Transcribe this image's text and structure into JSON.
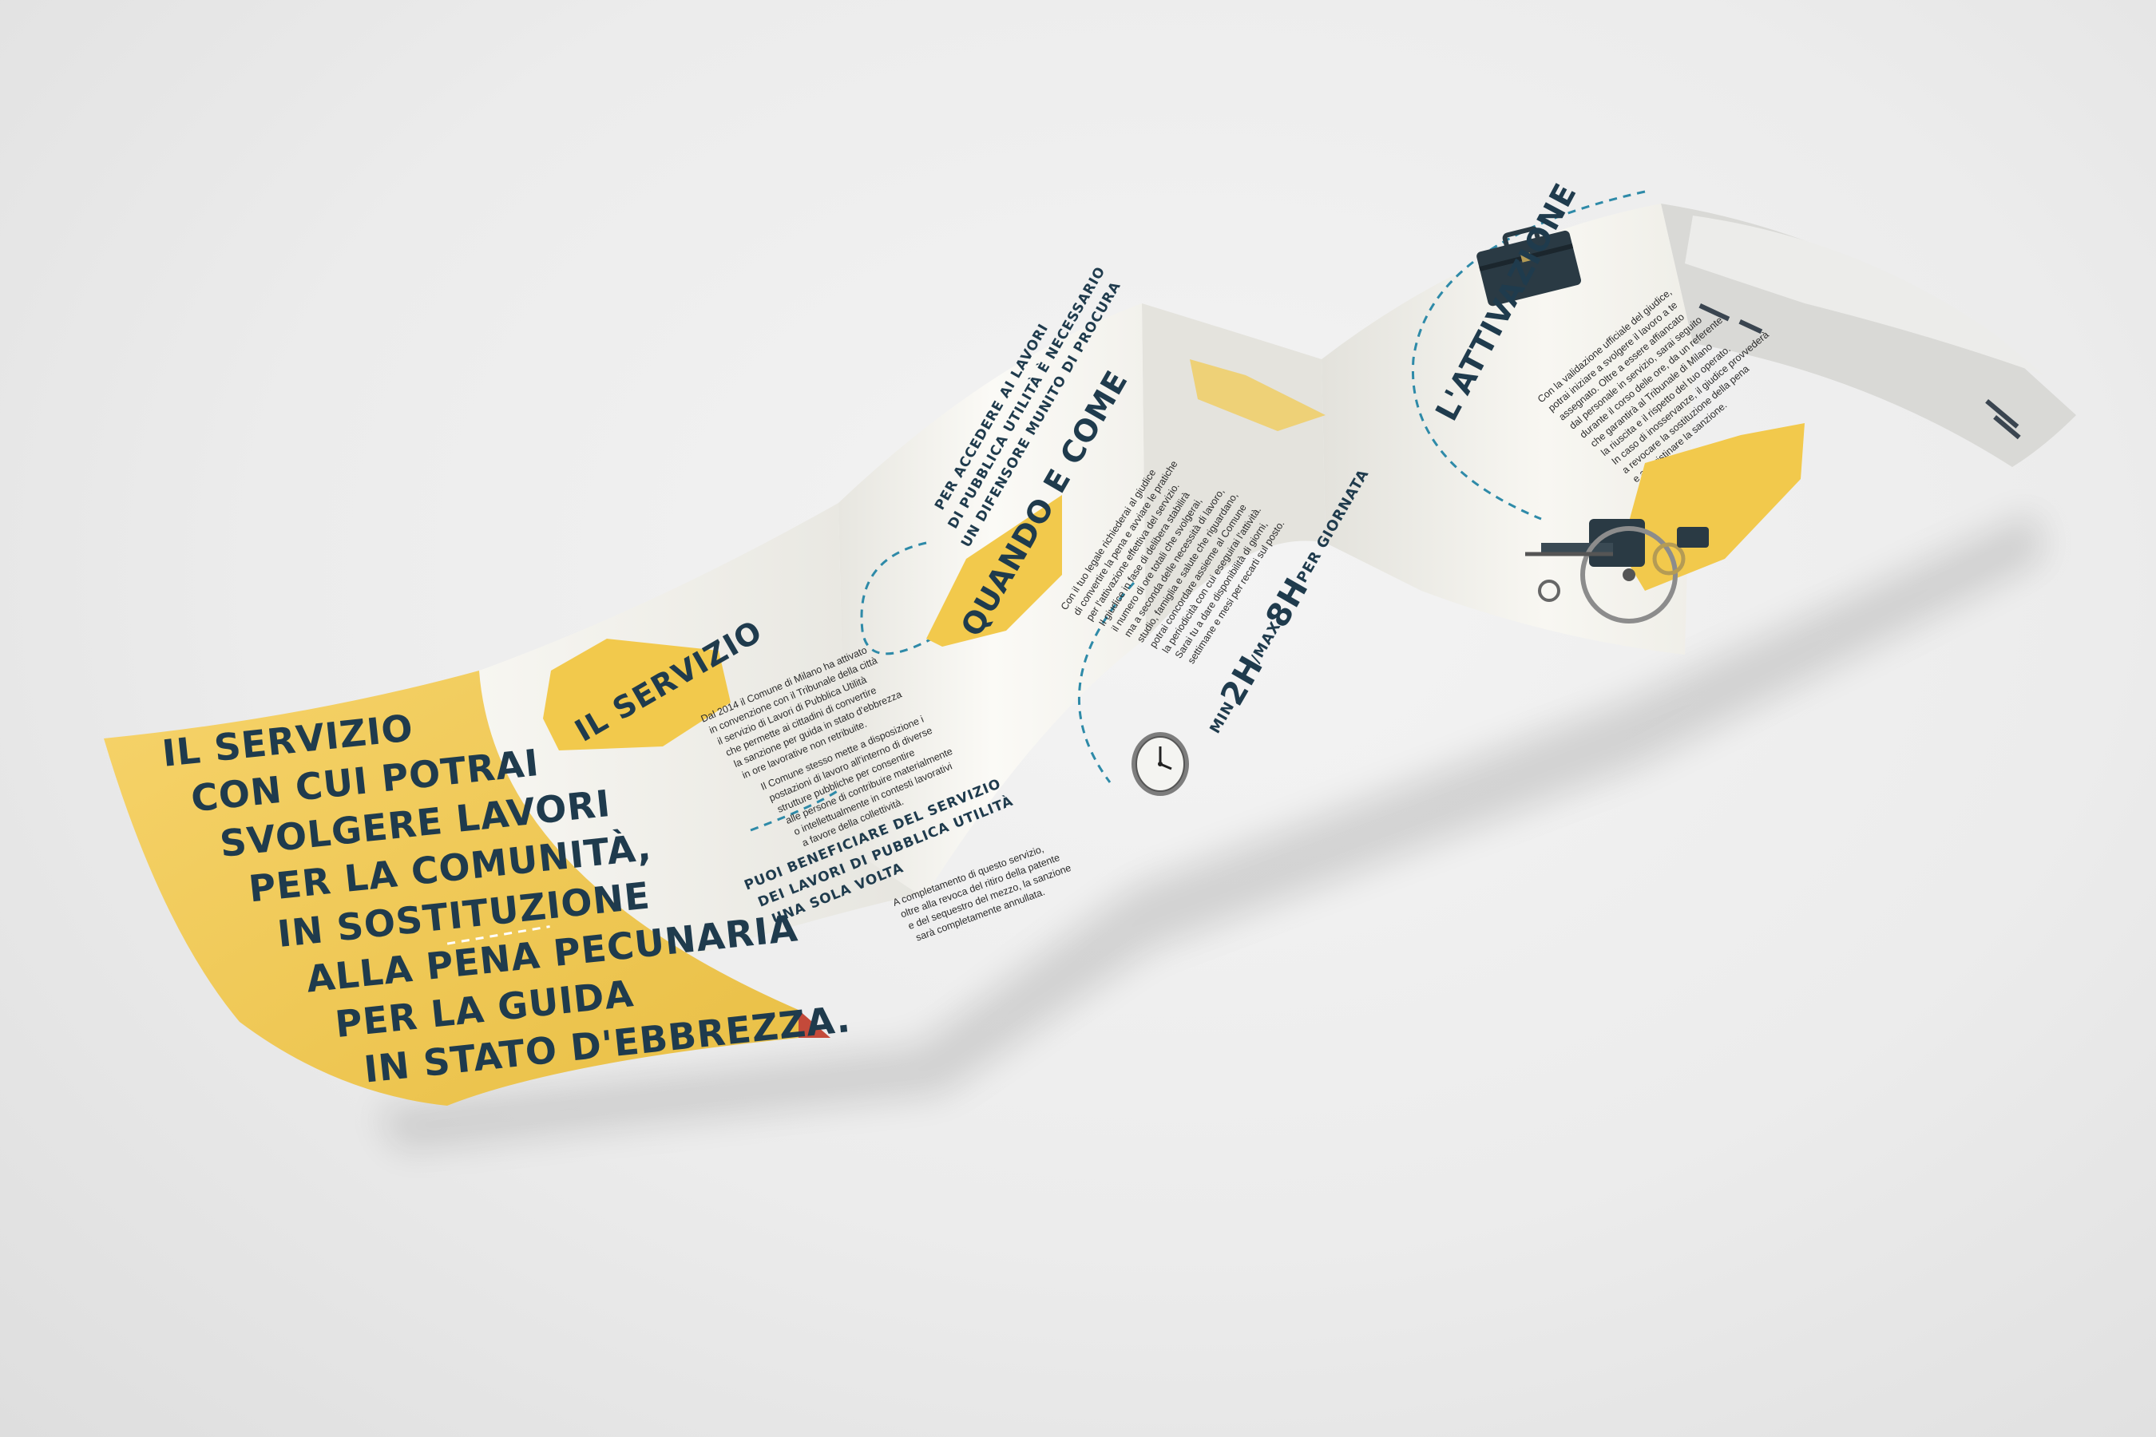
{
  "panel1": {
    "lines": [
      "IL SERVIZIO",
      "CON CUI POTRAI",
      "SVOLGERE LAVORI",
      "PER LA COMUNITÀ,",
      "IN SOSTITUZIONE",
      "ALLA PENA PECUNARIA",
      "PER LA GUIDA",
      "IN STATO D'EBBREZZA."
    ]
  },
  "panel2": {
    "title": "IL SERVIZIO",
    "para1": [
      "Dal 2014 il Comune di Milano ha attivato",
      "in convenzione con il Tribunale della città",
      "il servizio di Lavori di Pubblica Utilità",
      "che permette ai cittadini di convertire",
      "la sanzione per guida in stato d'ebbrezza",
      "in ore lavorative non retribuite."
    ],
    "para2": [
      "Il Comune stesso mette a disposizione i",
      "postazioni di lavoro all'interno di diverse",
      "strutture pubbliche per consentire",
      "alle persone di contribuire materialmente",
      "o intellettualmente in contesti lavorativi",
      "a favore della collettività."
    ],
    "note": [
      "PUOI BENEFICIARE DEL SERVIZIO",
      "DEI LAVORI DI PUBBLICA UTILITÀ",
      "UNA SOLA VOLTA"
    ],
    "para3": [
      "A completamento di questo servizio,",
      "oltre alla revoca del ritiro della patente",
      "e del sequestro del mezzo, la sanzione",
      "sarà completamente annullata."
    ]
  },
  "panel3": {
    "heading": [
      "PER ACCEDERE AI LAVORI",
      "DI PUBBLICA UTILITÀ È NECESSARIO",
      "UN DIFENSORE MUNITO DI PROCURA"
    ],
    "title": "QUANDO E COME",
    "para": [
      "Con il tuo legale richiederai al giudice",
      "di convertire la pena e avviare le pratiche",
      "per l'attivazione effettiva del servizio.",
      "Il giudice in fase di delibera stabilirà",
      "il numero di ore totali che svolgerai,",
      "ma a seconda delle necessità di lavoro,",
      "studio, famiglia e salute che riguardano,",
      "potrai concordare assieme al Comune",
      "la periodicità con cui eseguirai l'attività.",
      "Sarai tu a dare disponibilità di giorni,",
      "settimane e mesi per recarti sul posto."
    ],
    "hours": {
      "min_label": "MIN",
      "min": "2H",
      "max_label": "/MAX",
      "max": "8H",
      "unit": "PER GIORNATA"
    }
  },
  "panel4": {
    "title": "L'ATTIVAZIONE",
    "para": [
      "Con la validazione ufficiale del giudice,",
      "potrai iniziare a svolgere il lavoro a te",
      "assegnato. Oltre a essere affiancato",
      "dal personale in servizio, sarai seguito",
      "durante il corso delle ore, da un referente",
      "che garantirà al Tribunale di Milano",
      "la riuscita e il rispetto del tuo operato.",
      "In caso di inosservanze, il giudice provvederà",
      "a revocare la sostituzione della pena",
      "e a ripristinare la sanzione."
    ]
  },
  "colors": {
    "yellow": "#f2c94c",
    "navy": "#1f3b4d",
    "paper": "#f8f7f2",
    "teal_dash": "#2e8aa8"
  }
}
